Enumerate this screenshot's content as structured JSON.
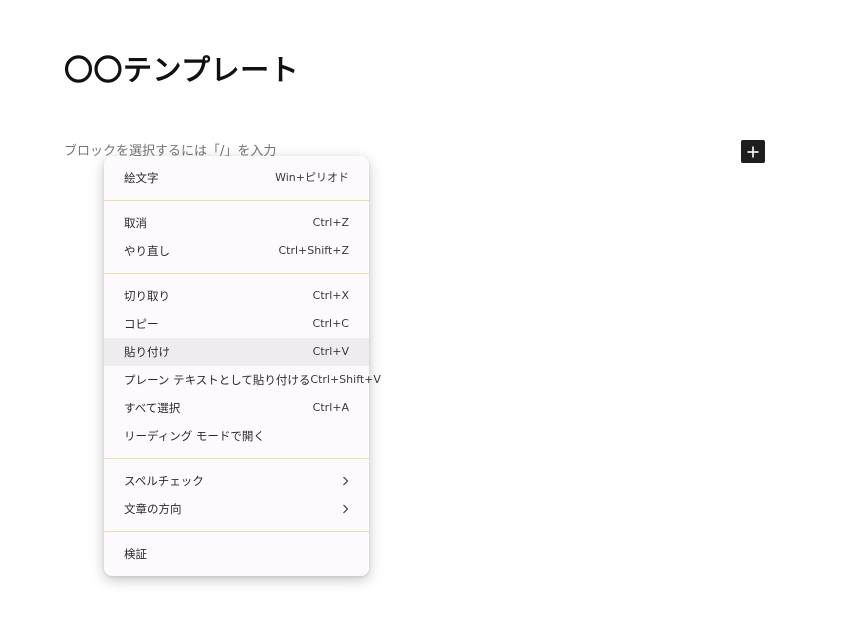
{
  "editor": {
    "title": "〇〇テンプレート",
    "placeholder": "ブロックを選択するには「/」を入力",
    "add_block_icon": "plus-icon"
  },
  "context_menu": {
    "groups": [
      [
        {
          "label": "絵文字",
          "shortcut": "Win+ピリオド"
        }
      ],
      [
        {
          "label": "取消",
          "shortcut": "Ctrl+Z"
        },
        {
          "label": "やり直し",
          "shortcut": "Ctrl+Shift+Z"
        }
      ],
      [
        {
          "label": "切り取り",
          "shortcut": "Ctrl+X"
        },
        {
          "label": "コピー",
          "shortcut": "Ctrl+C"
        },
        {
          "label": "貼り付け",
          "shortcut": "Ctrl+V",
          "highlighted": true
        },
        {
          "label": "プレーン テキストとして貼り付ける",
          "shortcut": "Ctrl+Shift+V"
        },
        {
          "label": "すべて選択",
          "shortcut": "Ctrl+A"
        },
        {
          "label": "リーディング モードで開く",
          "shortcut": ""
        }
      ],
      [
        {
          "label": "スペルチェック",
          "submenu": true
        },
        {
          "label": "文章の方向",
          "submenu": true
        }
      ],
      [
        {
          "label": "検証",
          "shortcut": ""
        }
      ]
    ],
    "separator_color": "#ece3a6",
    "highlight_color": "#efecef"
  }
}
